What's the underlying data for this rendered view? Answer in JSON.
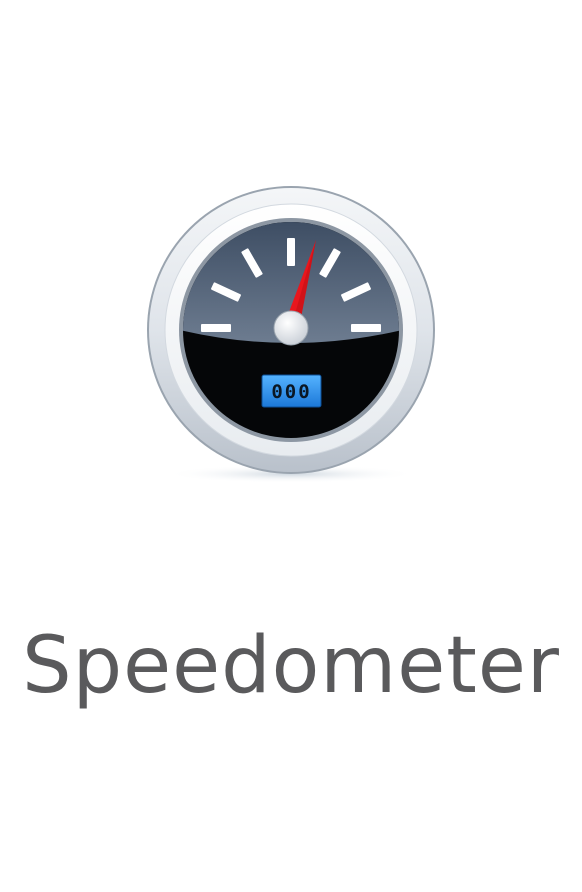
{
  "app": {
    "title": "Speedometer"
  },
  "gauge": {
    "odometer": "000",
    "needle_color": "#e8161d",
    "odometer_color": "#2a8ee8",
    "tick_color": "#ffffff"
  }
}
